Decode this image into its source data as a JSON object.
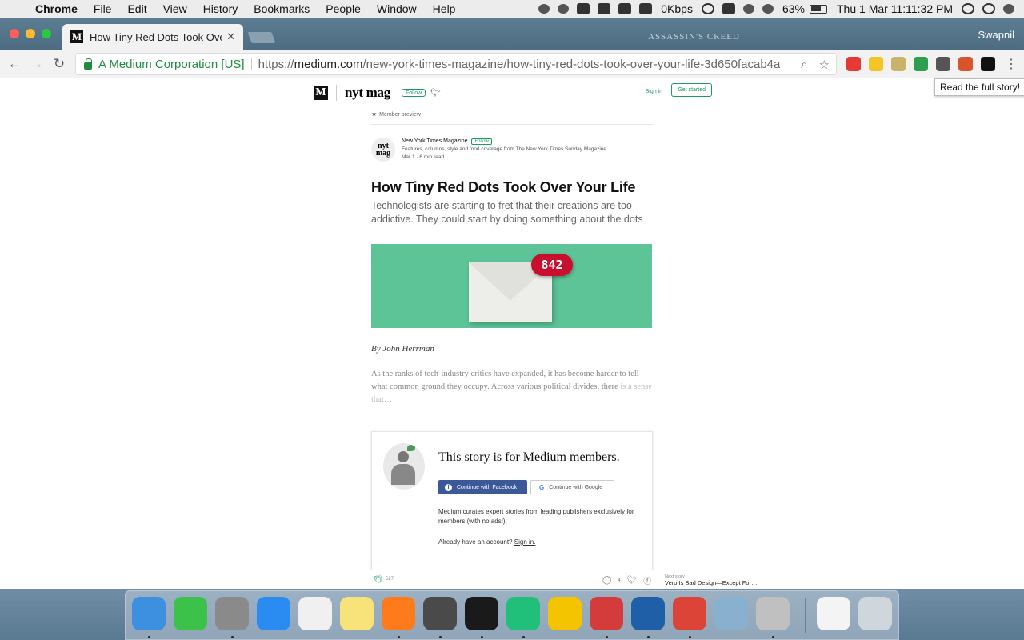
{
  "menubar": {
    "app": "Chrome",
    "items": [
      "File",
      "Edit",
      "View",
      "History",
      "Bookmarks",
      "People",
      "Window",
      "Help"
    ],
    "network": "0Kbps",
    "battery": "63%",
    "clock": "Thu 1 Mar  11:11:32 PM"
  },
  "browser": {
    "tab_title": "How Tiny Red Dots Took Over",
    "profile": "Swapnil",
    "wallpaper_text": "ASSASSIN'S CREED",
    "ev_cert": "A Medium Corporation [US]",
    "url_scheme": "https://",
    "url_host": "medium.com",
    "url_path": "/new-york-times-magazine/how-tiny-red-dots-took-over-your-life-3d650facab4a",
    "tooltip": "Read the full story!",
    "extension_colors": [
      "#e53935",
      "#f3c623",
      "#c9b36a",
      "#2e9e4f",
      "#555555",
      "#d9542b",
      "#111111"
    ]
  },
  "medium_header": {
    "logo": "M",
    "publication": "nyt mag",
    "follow": "Follow",
    "signin": "Sign in",
    "get_started": "Get started"
  },
  "article": {
    "member_preview": "Member preview",
    "author_avatar": "nyt mag",
    "author_name": "New York Times Magazine",
    "author_follow": "Follow",
    "author_bio": "Features, columns, style and food coverage from The New York Times Sunday Magazine.",
    "meta": "Mar 1 · 6 min read",
    "title": "How Tiny Red Dots Took Over Your Life",
    "subtitle": "Technologists are starting to fret that their creations are too addictive. They could start by doing something about the dots",
    "hero_badge": "842",
    "byline": "By John Herrman",
    "body_visible": "As the ranks of tech-industry critics have expanded, it has become harder to tell what common ground they occupy. Across various political divides, there",
    "body_fade": "is a sense that…"
  },
  "paywall": {
    "title": "This story is for Medium members.",
    "facebook_btn": "Continue with Facebook",
    "google_btn": "Continue with Google",
    "description": "Medium curates expert stories from leading publishers exclusively for members (with no ads!).",
    "already": "Already have an account?",
    "signin_link": "Sign in."
  },
  "bottombar": {
    "claps": "527",
    "responses": "4",
    "next_label": "Next story",
    "next_title": "Vero Is Bad Design—Except For…"
  },
  "dock": {
    "apps": [
      {
        "name": "Finder",
        "color": "#3d8fe0"
      },
      {
        "name": "FaceTime",
        "color": "#3cc24a"
      },
      {
        "name": "System Preferences",
        "color": "#8a8a8a"
      },
      {
        "name": "App Store",
        "color": "#2a8cf0"
      },
      {
        "name": "iTunes",
        "color": "#f0f0f0"
      },
      {
        "name": "Notes",
        "color": "#f7e37a"
      },
      {
        "name": "Firefox",
        "color": "#ff7a1a"
      },
      {
        "name": "Sublime Text",
        "color": "#4a4a4a"
      },
      {
        "name": "Terminal",
        "color": "#1a1a1a"
      },
      {
        "name": "PyCharm",
        "color": "#20c07a"
      },
      {
        "name": "Tes",
        "color": "#f5c400"
      },
      {
        "name": "Bear",
        "color": "#d43b3b"
      },
      {
        "name": "VS Code",
        "color": "#1f5fa8"
      },
      {
        "name": "Chrome",
        "color": "#db4437"
      },
      {
        "name": "Preview",
        "color": "#8ab0d0"
      },
      {
        "name": "Scissors",
        "color": "#c0c0c0"
      },
      {
        "name": "Screen",
        "color": "#f4f4f4"
      },
      {
        "name": "Trash",
        "color": "#cfd6dc"
      }
    ]
  }
}
